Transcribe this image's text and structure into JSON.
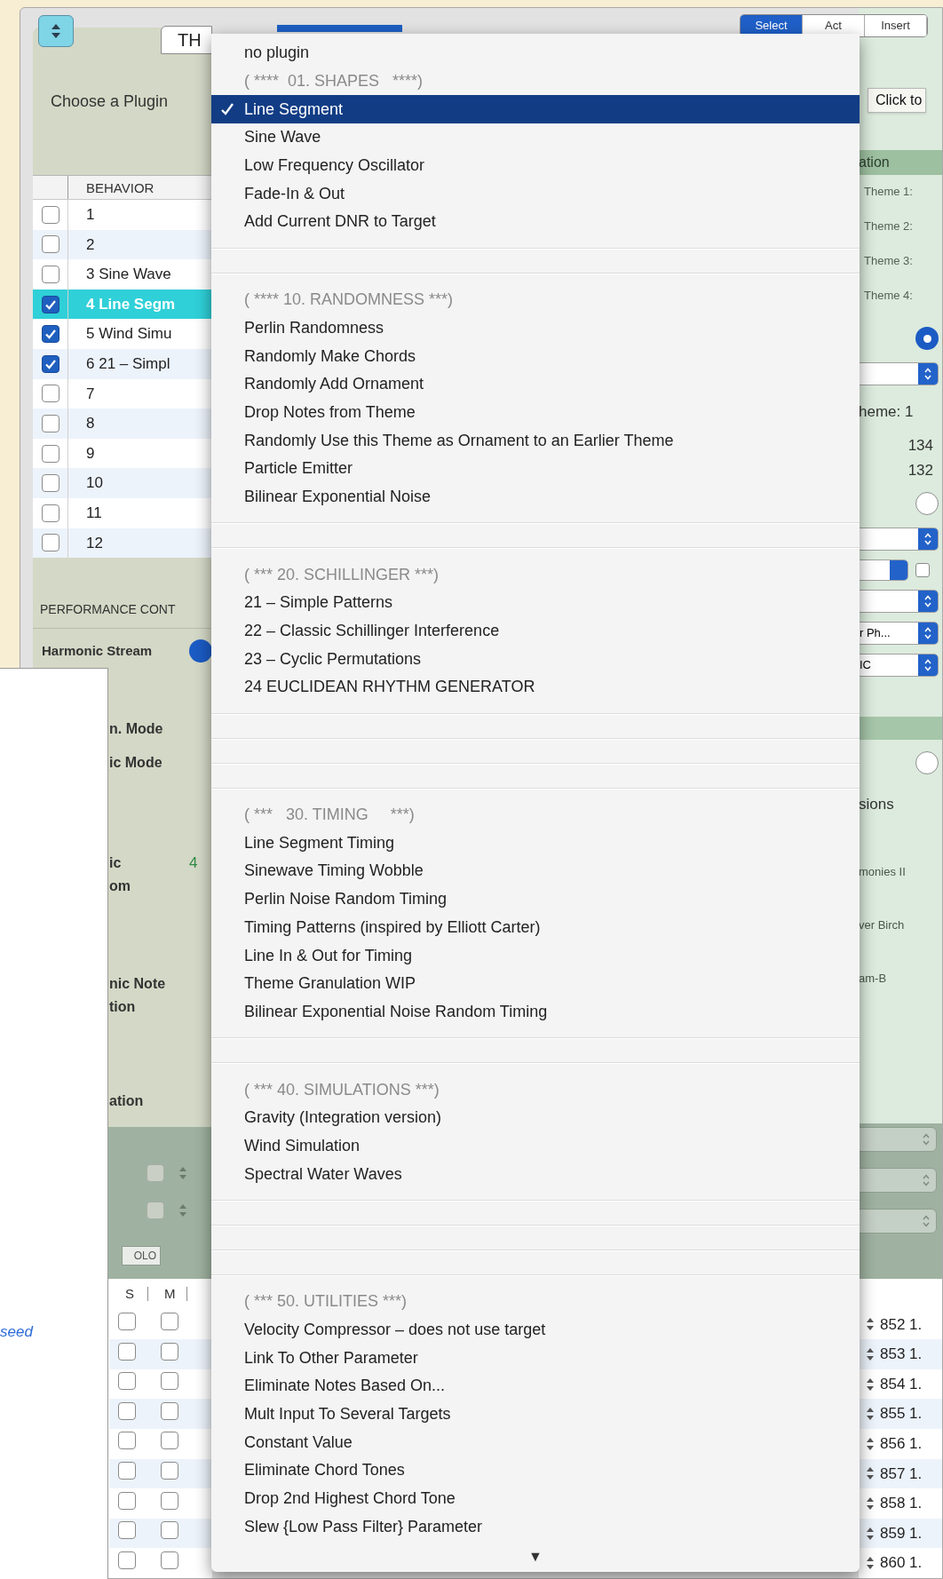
{
  "toolbar": {
    "segments": [
      {
        "label": "Select",
        "selected": true
      },
      {
        "label": "Act",
        "selected": false
      },
      {
        "label": "Insert",
        "selected": false
      }
    ]
  },
  "plugin_panel": {
    "tab": "TH",
    "label": "Choose a Plugin"
  },
  "behavior_table": {
    "column": "BEHAVIOR",
    "rows": [
      {
        "label": "1",
        "checked": false,
        "selected": false
      },
      {
        "label": "2",
        "checked": false,
        "selected": false
      },
      {
        "label": "3 Sine Wave",
        "checked": false,
        "selected": false
      },
      {
        "label": "4 Line Segm",
        "checked": true,
        "selected": true
      },
      {
        "label": "5 Wind Simu",
        "checked": true,
        "selected": false
      },
      {
        "label": "6 21 – Simpl",
        "checked": true,
        "selected": false
      },
      {
        "label": "7",
        "checked": false,
        "selected": false
      },
      {
        "label": "8",
        "checked": false,
        "selected": false
      },
      {
        "label": "9",
        "checked": false,
        "selected": false
      },
      {
        "label": "10",
        "checked": false,
        "selected": false
      },
      {
        "label": "11",
        "checked": false,
        "selected": false
      },
      {
        "label": "12",
        "checked": false,
        "selected": false
      }
    ]
  },
  "performance": {
    "title": "PERFORMANCE CONT",
    "stream_label": "Harmonic Stream",
    "labels": [
      "n. Mode",
      "ic Mode",
      "ic",
      "om",
      "nic Note",
      "tion",
      "ation"
    ],
    "value": "4"
  },
  "side_window": {
    "link": "seed"
  },
  "lower_panel": {
    "left_checks": [
      {
        "checked": false
      },
      {
        "checked": false
      }
    ],
    "solo": "OLO",
    "right_selects": [
      {
        "disabled": true
      },
      {
        "disabled": true
      },
      {
        "disabled": true
      }
    ]
  },
  "track_table": {
    "columns": [
      "S",
      "M"
    ],
    "rows": [
      {
        "s": false,
        "m": false,
        "number": "852 1."
      },
      {
        "s": false,
        "m": false,
        "number": "853 1."
      },
      {
        "s": false,
        "m": false,
        "number": "854 1."
      },
      {
        "s": false,
        "m": false,
        "number": "855 1."
      },
      {
        "s": false,
        "m": false,
        "number": "856 1."
      },
      {
        "s": false,
        "m": false,
        "number": "857 1."
      },
      {
        "s": false,
        "m": false,
        "number": "858 1."
      },
      {
        "s": false,
        "m": false,
        "number": "859 1."
      },
      {
        "s": false,
        "m": false,
        "number": "860 1."
      }
    ]
  },
  "right_strip": [
    {
      "kind": "tooltip",
      "text": "Click to"
    },
    {
      "kind": "header",
      "text": "ation"
    },
    {
      "kind": "label",
      "text": "Theme 1:"
    },
    {
      "kind": "label",
      "text": "Theme 2:"
    },
    {
      "kind": "label",
      "text": "Theme 3:"
    },
    {
      "kind": "label",
      "text": "Theme 4:"
    },
    {
      "kind": "radio",
      "selected": true
    },
    {
      "kind": "select"
    },
    {
      "kind": "text",
      "text": "heme: 1"
    },
    {
      "kind": "number",
      "text": "134"
    },
    {
      "kind": "number",
      "text": "132"
    },
    {
      "kind": "radio",
      "selected": false
    },
    {
      "kind": "select"
    },
    {
      "kind": "select_check",
      "checked": false
    },
    {
      "kind": "select"
    },
    {
      "kind": "select",
      "text": "r Ph..."
    },
    {
      "kind": "select",
      "text": "IC"
    },
    {
      "kind": "band"
    },
    {
      "kind": "radio",
      "selected": false
    },
    {
      "kind": "text",
      "text": "sions"
    },
    {
      "kind": "small",
      "text": "monies II"
    },
    {
      "kind": "small",
      "text": "ver Birch"
    },
    {
      "kind": "small",
      "text": "am-B"
    }
  ],
  "menu": {
    "entries": [
      {
        "kind": "item",
        "text": "no plugin",
        "selected": false
      },
      {
        "kind": "header",
        "text": "( ****  01. SHAPES   ****)"
      },
      {
        "kind": "item",
        "text": "Line Segment",
        "selected": true
      },
      {
        "kind": "item",
        "text": "Sine Wave",
        "selected": false
      },
      {
        "kind": "item",
        "text": "Low Frequency Oscillator",
        "selected": false
      },
      {
        "kind": "item",
        "text": "Fade-In & Out",
        "selected": false
      },
      {
        "kind": "item",
        "text": "Add Current DNR to Target",
        "selected": false
      },
      {
        "kind": "separator"
      },
      {
        "kind": "separator"
      },
      {
        "kind": "header",
        "text": "( **** 10. RANDOMNESS ***)"
      },
      {
        "kind": "item",
        "text": "Perlin Randomness",
        "selected": false
      },
      {
        "kind": "item",
        "text": "Randomly Make Chords",
        "selected": false
      },
      {
        "kind": "item",
        "text": "Randomly Add Ornament",
        "selected": false
      },
      {
        "kind": "item",
        "text": "Drop Notes from Theme",
        "selected": false
      },
      {
        "kind": "item",
        "text": "Randomly Use this Theme as Ornament to an Earlier Theme",
        "selected": false
      },
      {
        "kind": "item",
        "text": "Particle Emitter",
        "selected": false
      },
      {
        "kind": "item",
        "text": "Bilinear Exponential Noise",
        "selected": false
      },
      {
        "kind": "separator"
      },
      {
        "kind": "separator"
      },
      {
        "kind": "header",
        "text": "( *** 20. SCHILLINGER ***)"
      },
      {
        "kind": "item",
        "text": "21 – Simple Patterns",
        "selected": false
      },
      {
        "kind": "item",
        "text": "22 – Classic Schillinger Interference",
        "selected": false
      },
      {
        "kind": "item",
        "text": "23 – Cyclic Permutations",
        "selected": false
      },
      {
        "kind": "item",
        "text": "24 EUCLIDEAN RHYTHM GENERATOR",
        "selected": false
      },
      {
        "kind": "separator"
      },
      {
        "kind": "separator"
      },
      {
        "kind": "separator"
      },
      {
        "kind": "separator"
      },
      {
        "kind": "header",
        "text": "( ***   30. TIMING     ***)"
      },
      {
        "kind": "item",
        "text": "Line Segment Timing",
        "selected": false
      },
      {
        "kind": "item",
        "text": "Sinewave Timing Wobble",
        "selected": false
      },
      {
        "kind": "item",
        "text": "Perlin Noise Random Timing",
        "selected": false
      },
      {
        "kind": "item",
        "text": "Timing Patterns (inspired by Elliott Carter)",
        "selected": false
      },
      {
        "kind": "item",
        "text": "Line In & Out for Timing",
        "selected": false
      },
      {
        "kind": "item",
        "text": "Theme Granulation WIP",
        "selected": false
      },
      {
        "kind": "item",
        "text": "Bilinear Exponential Noise Random Timing",
        "selected": false
      },
      {
        "kind": "separator"
      },
      {
        "kind": "separator"
      },
      {
        "kind": "header",
        "text": "( *** 40. SIMULATIONS ***)"
      },
      {
        "kind": "item",
        "text": "Gravity (Integration version)",
        "selected": false
      },
      {
        "kind": "item",
        "text": "Wind Simulation",
        "selected": false
      },
      {
        "kind": "item",
        "text": "Spectral Water Waves",
        "selected": false
      },
      {
        "kind": "separator"
      },
      {
        "kind": "separator"
      },
      {
        "kind": "separator"
      },
      {
        "kind": "separator"
      },
      {
        "kind": "header",
        "text": "( *** 50. UTILITIES ***)"
      },
      {
        "kind": "item",
        "text": "Velocity Compressor – does not use target",
        "selected": false
      },
      {
        "kind": "item",
        "text": "Link To Other Parameter",
        "selected": false
      },
      {
        "kind": "item",
        "text": "Eliminate Notes Based On...",
        "selected": false
      },
      {
        "kind": "item",
        "text": "Mult Input To Several Targets",
        "selected": false
      },
      {
        "kind": "item",
        "text": "Constant Value",
        "selected": false
      },
      {
        "kind": "item",
        "text": "Eliminate Chord Tones",
        "selected": false
      },
      {
        "kind": "item",
        "text": "Drop 2nd Highest Chord Tone",
        "selected": false
      },
      {
        "kind": "item",
        "text": "Slew {Low Pass Filter} Parameter",
        "selected": false
      }
    ],
    "more_arrow": "▼"
  }
}
